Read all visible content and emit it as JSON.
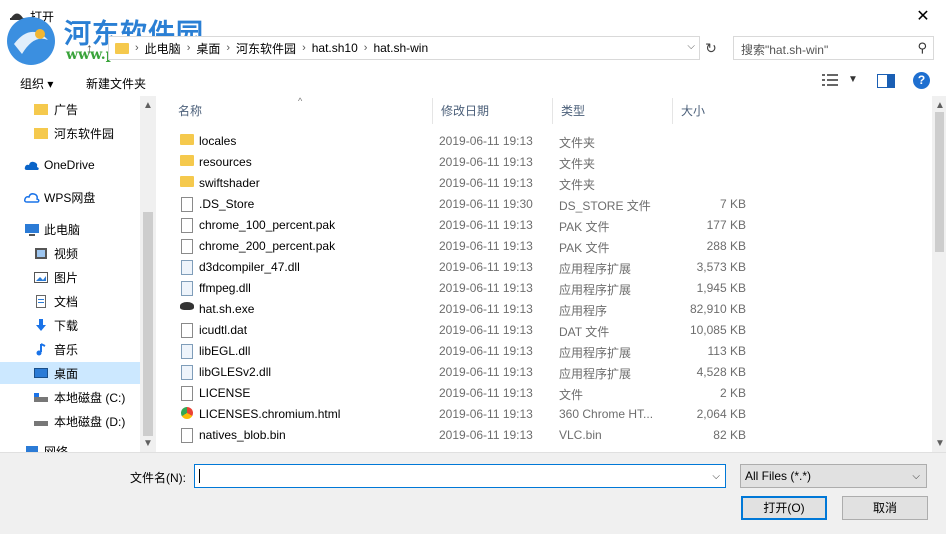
{
  "window": {
    "title": "打开",
    "close_glyph": "✕"
  },
  "watermark": {
    "name": "河东软件园",
    "url": "www.pc0359.cn"
  },
  "address": {
    "crumbs": [
      "此电脑",
      "桌面",
      "河东软件园",
      "hat.sh10",
      "hat.sh-win"
    ]
  },
  "search": {
    "placeholder": "搜索\"hat.sh-win\""
  },
  "toolbar": {
    "organize": "组织 ▾",
    "new_folder": "新建文件夹",
    "help": "?"
  },
  "columns": {
    "name": "名称",
    "date": "修改日期",
    "type": "类型",
    "size": "大小"
  },
  "nav": [
    {
      "label": "广告",
      "icon": "folder-icon"
    },
    {
      "label": "河东软件园",
      "icon": "folder-icon"
    },
    {
      "label": "OneDrive",
      "icon": "cloud-icon"
    },
    {
      "label": "WPS网盘",
      "icon": "wps-cloud-icon"
    },
    {
      "label": "此电脑",
      "icon": "computer-icon"
    },
    {
      "label": "视频",
      "icon": "video-icon"
    },
    {
      "label": "图片",
      "icon": "pictures-icon"
    },
    {
      "label": "文档",
      "icon": "documents-icon"
    },
    {
      "label": "下载",
      "icon": "download-icon"
    },
    {
      "label": "音乐",
      "icon": "music-icon"
    },
    {
      "label": "桌面",
      "icon": "desktop-icon",
      "selected": true
    },
    {
      "label": "本地磁盘 (C:)",
      "icon": "drive-icon"
    },
    {
      "label": "本地磁盘 (D:)",
      "icon": "drive-icon"
    },
    {
      "label": "网络",
      "icon": "network-icon"
    }
  ],
  "files": [
    {
      "name": "locales",
      "date": "2019-06-11 19:13",
      "type": "文件夹",
      "size": "",
      "icon": "folder"
    },
    {
      "name": "resources",
      "date": "2019-06-11 19:13",
      "type": "文件夹",
      "size": "",
      "icon": "folder"
    },
    {
      "name": "swiftshader",
      "date": "2019-06-11 19:13",
      "type": "文件夹",
      "size": "",
      "icon": "folder"
    },
    {
      "name": ".DS_Store",
      "date": "2019-06-11 19:30",
      "type": "DS_STORE 文件",
      "size": "7 KB",
      "icon": "doc"
    },
    {
      "name": "chrome_100_percent.pak",
      "date": "2019-06-11 19:13",
      "type": "PAK 文件",
      "size": "177 KB",
      "icon": "doc"
    },
    {
      "name": "chrome_200_percent.pak",
      "date": "2019-06-11 19:13",
      "type": "PAK 文件",
      "size": "288 KB",
      "icon": "doc"
    },
    {
      "name": "d3dcompiler_47.dll",
      "date": "2019-06-11 19:13",
      "type": "应用程序扩展",
      "size": "3,573 KB",
      "icon": "dll"
    },
    {
      "name": "ffmpeg.dll",
      "date": "2019-06-11 19:13",
      "type": "应用程序扩展",
      "size": "1,945 KB",
      "icon": "dll"
    },
    {
      "name": "hat.sh.exe",
      "date": "2019-06-11 19:13",
      "type": "应用程序",
      "size": "82,910 KB",
      "icon": "exe"
    },
    {
      "name": "icudtl.dat",
      "date": "2019-06-11 19:13",
      "type": "DAT 文件",
      "size": "10,085 KB",
      "icon": "doc"
    },
    {
      "name": "libEGL.dll",
      "date": "2019-06-11 19:13",
      "type": "应用程序扩展",
      "size": "113 KB",
      "icon": "dll"
    },
    {
      "name": "libGLESv2.dll",
      "date": "2019-06-11 19:13",
      "type": "应用程序扩展",
      "size": "4,528 KB",
      "icon": "dll"
    },
    {
      "name": "LICENSE",
      "date": "2019-06-11 19:13",
      "type": "文件",
      "size": "2 KB",
      "icon": "doc"
    },
    {
      "name": "LICENSES.chromium.html",
      "date": "2019-06-11 19:13",
      "type": "360 Chrome HT...",
      "size": "2,064 KB",
      "icon": "chrome"
    },
    {
      "name": "natives_blob.bin",
      "date": "2019-06-11 19:13",
      "type": "VLC.bin",
      "size": "82 KB",
      "icon": "doc"
    }
  ],
  "footer": {
    "filename_label": "文件名(N):",
    "filename_value": "",
    "filter": "All Files (*.*)",
    "open": "打开(O)",
    "cancel": "取消"
  }
}
